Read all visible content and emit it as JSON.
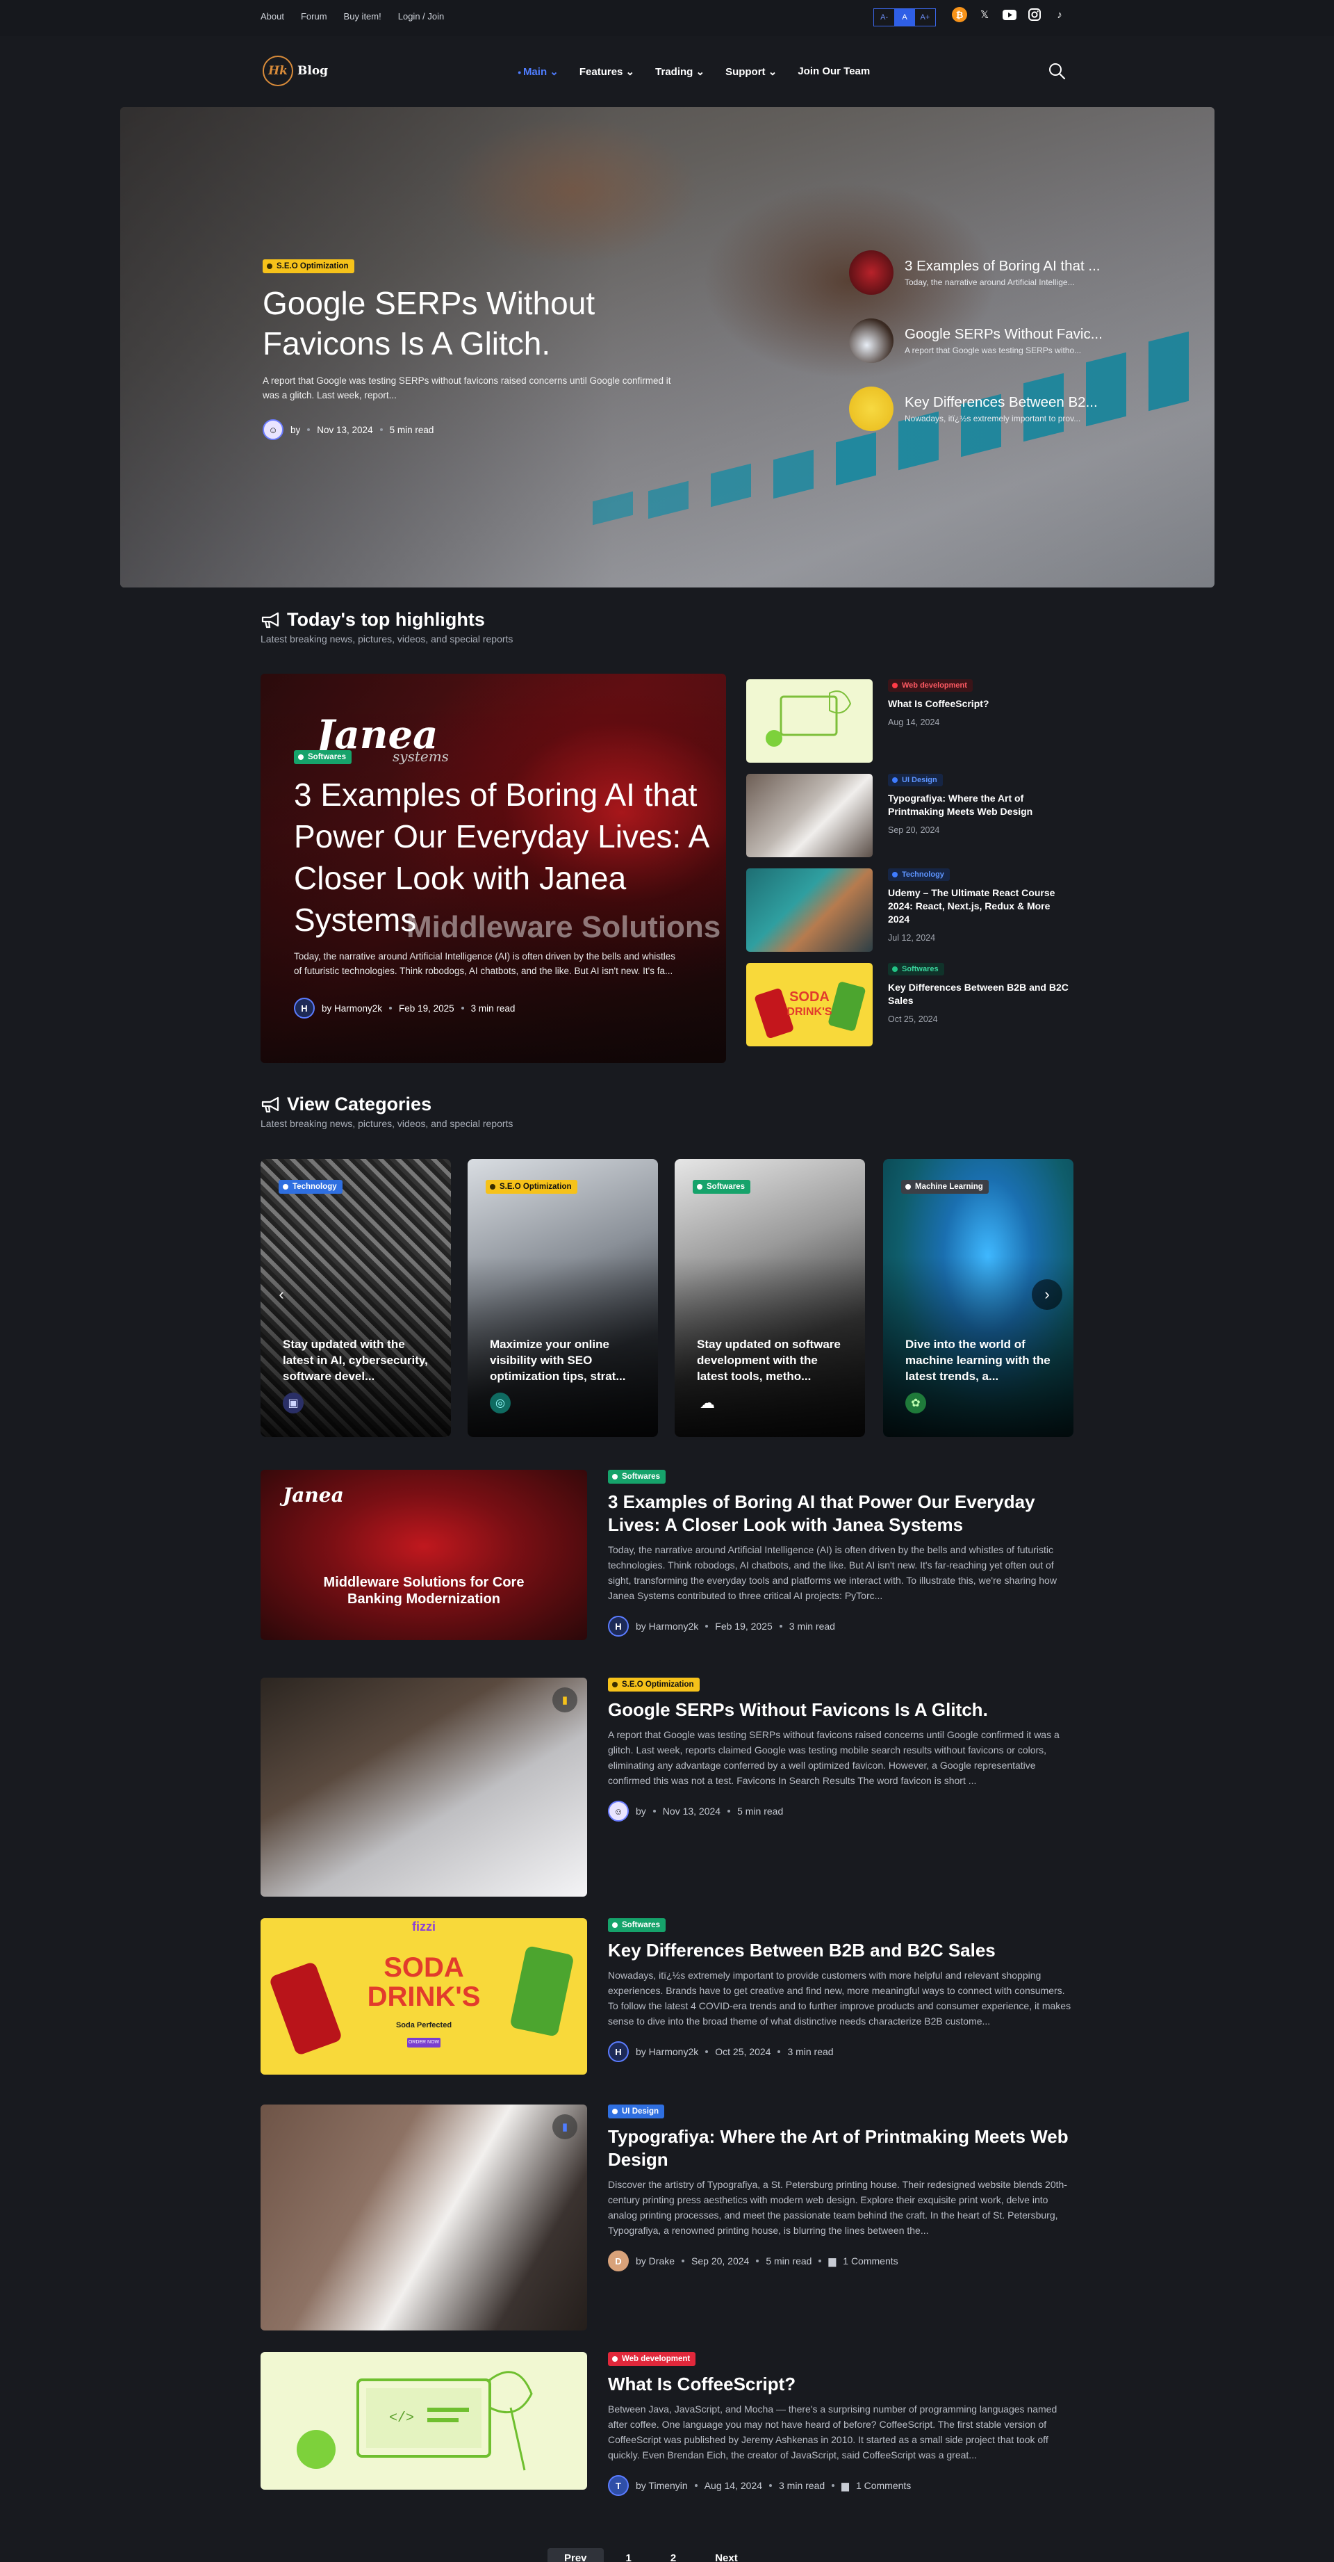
{
  "topbar": {
    "links": [
      "About",
      "Forum",
      "Buy item!",
      "Login / Join"
    ],
    "font_controls": [
      "A-",
      "A",
      "A+"
    ],
    "social_icons": [
      "bitcoin-icon",
      "x-icon",
      "youtube-icon",
      "instagram-icon",
      "tiktok-icon"
    ]
  },
  "header": {
    "logo_mark": "Hk",
    "logo_text": "Blog",
    "nav": [
      "Main",
      "Features",
      "Trading",
      "Support",
      "Join Our Team"
    ],
    "active_nav": "Main"
  },
  "hero": {
    "badge": "S.E.O Optimization",
    "title": "Google SERPs Without Favicons Is A Glitch.",
    "excerpt": "A report that Google was testing SERPs without favicons raised concerns until Google confirmed it was a glitch. Last week, report...",
    "author": "by",
    "date": "Nov 13, 2024",
    "read": "5 min read",
    "side": [
      {
        "title": "3 Examples of Boring AI that ...",
        "sub": "Today, the narrative around Artificial Intellige..."
      },
      {
        "title": "Google SERPs Without Favic...",
        "sub": "A report that Google was testing SERPs witho..."
      },
      {
        "title": "Key Differences Between B2...",
        "sub": "Nowadays, itï¿½s extremely important to prov..."
      }
    ]
  },
  "highlights": {
    "title": "Today's top highlights",
    "subtitle": "Latest breaking news, pictures, videos, and special reports",
    "feature": {
      "logo": "Janea",
      "logo_sub": "systems",
      "bg_text": "Middleware Solutions",
      "badge": "Softwares",
      "title": "3 Examples of Boring AI that Power Our Everyday Lives: A Closer Look with Janea Systems",
      "excerpt": "Today, the narrative around Artificial Intelligence (AI) is often driven by the bells and whistles of futuristic technologies. Think robodogs, AI chatbots, and the like. But AI isn't new. It's fa...",
      "author_initial": "H",
      "author": "by Harmony2k",
      "date": "Feb 19, 2025",
      "read": "3 min read"
    },
    "items": [
      {
        "badge": "Web development",
        "title": "What Is CoffeeScript?",
        "date": "Aug 14, 2024"
      },
      {
        "badge": "UI Design",
        "title": "Typografiya: Where the Art of Printmaking Meets Web Design",
        "date": "Sep 20, 2024"
      },
      {
        "badge": "Technology",
        "title": "Udemy – The Ultimate React Course 2024: React, Next.js, Redux & More 2024",
        "date": "Jul 12, 2024"
      },
      {
        "badge": "Softwares",
        "title": "Key Differences Between B2B and B2C Sales",
        "date": "Oct 25, 2024"
      }
    ]
  },
  "categories": {
    "title": "View Categories",
    "subtitle": "Latest breaking news, pictures, videos, and special reports",
    "cards": [
      {
        "badge": "Technology",
        "text": "Stay updated with the latest in AI, cybersecurity, software devel..."
      },
      {
        "badge": "S.E.O Optimization",
        "text": "Maximize your online visibility with SEO optimization tips, strat..."
      },
      {
        "badge": "Softwares",
        "text": "Stay updated on software development with the latest tools, metho..."
      },
      {
        "badge": "Machine Learning",
        "text": "Dive into the world of machine learning with the latest trends, a..."
      }
    ],
    "prev_icon": "‹",
    "next_icon": "›"
  },
  "posts": [
    {
      "badge": "Softwares",
      "title": "3 Examples of Boring AI that Power Our Everyday Lives: A Closer Look with Janea Systems",
      "excerpt": "Today, the narrative around Artificial Intelligence (AI) is often driven by the bells and whistles of futuristic technologies. Think robodogs, AI chatbots, and the like. But AI isn't new. It's far-reaching yet often out of sight, transforming the everyday tools and platforms we interact with. To illustrate this, we're sharing how Janea Systems contributed to three critical AI projects: PyTorc...",
      "author_initial": "H",
      "author": "by Harmony2k",
      "date": "Feb 19, 2025",
      "read": "3 min read",
      "image_logo": "Janea",
      "image_caption": "Middleware Solutions for Core Banking Modernization"
    },
    {
      "badge": "S.E.O Optimization",
      "title": "Google SERPs Without Favicons Is A Glitch.",
      "excerpt": "A report that Google was testing SERPs without favicons raised concerns until Google confirmed it was a glitch. Last week, reports claimed Google was testing mobile search results without favicons or colors, eliminating any advantage conferred by a well optimized favicon. However, a Google representative confirmed this was not a test. Favicons In Search Results The word favicon is short ...",
      "author_initial": "",
      "author": "by",
      "date": "Nov 13, 2024",
      "read": "5 min read"
    },
    {
      "badge": "Softwares",
      "title": "Key Differences Between B2B and B2C Sales",
      "excerpt": "Nowadays, itï¿½s extremely important to provide customers with more helpful and relevant shopping experiences. Brands have to get creative and find new, more meaningful ways to connect with consumers. To follow the latest 4 COVID-era trends and to further improve products and consumer experience, it makes sense to dive into the broad theme of what distinctive needs characterize B2B custome...",
      "author_initial": "H",
      "author": "by Harmony2k",
      "date": "Oct 25, 2024",
      "read": "3 min read",
      "image_brand": "fizzi",
      "image_title": "SODA DRINK'S",
      "image_sub": "Soda Perfected",
      "image_btn": "ORDER NOW"
    },
    {
      "badge": "UI Design",
      "title": "Typografiya: Where the Art of Printmaking Meets Web Design",
      "excerpt": "Discover the artistry of Typografiya, a St. Petersburg printing house. Their redesigned website blends 20th-century printing press aesthetics with modern web design. Explore their exquisite print work, delve into analog printing processes, and meet the passionate team behind the craft. In the heart of St. Petersburg, Typografiya, a renowned printing house, is blurring the lines between the...",
      "author_initial": "D",
      "author": "by Drake",
      "date": "Sep 20, 2024",
      "read": "5 min read",
      "comments": "1 Comments"
    },
    {
      "badge": "Web development",
      "title": "What Is CoffeeScript?",
      "excerpt": "Between Java, JavaScript, and Mocha — there's a surprising number of programming languages named after coffee. One language you may not have heard of before? CoffeeScript. The first stable version of CoffeeScript was published by Jeremy Ashkenas in 2010. It started as a small side project that took off quickly. Even Brendan Eich, the creator of JavaScript, said CoffeeScript was a great...",
      "author_initial": "T",
      "author": "by Timenyin",
      "date": "Aug 14, 2024",
      "read": "3 min read",
      "comments": "1 Comments"
    }
  ],
  "pagination": [
    "Prev",
    "1",
    "2",
    "Next"
  ],
  "colors": {
    "accent": "#4f7dff",
    "seo": "#f6c21a",
    "softwares": "#16a36b",
    "ui_design": "#2f6fe0",
    "web_dev": "#e1283b",
    "bg": "#181a1f"
  }
}
